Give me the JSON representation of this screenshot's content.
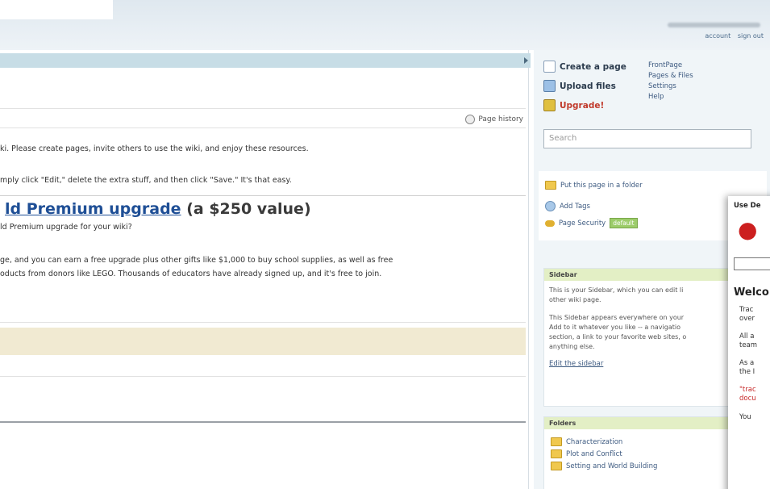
{
  "header": {
    "account_link": "account",
    "signout_link": "sign out"
  },
  "main": {
    "page_history": "Page history",
    "welcome_line": "ki.  Please create pages, invite others to use the wiki, and enjoy these resources.",
    "edit_line": "mply click \"Edit,\" delete the extra stuff, and then click \"Save.\"  It's that easy.",
    "promo_link": "ld Premium upgrade",
    "promo_value": " (a $250 value)",
    "promo_sub": "ld Premium upgrade for your wiki?",
    "promo_body_1": "ge, and you can earn a free upgrade plus other gifts like $1,000 to buy school supplies, as well as free",
    "promo_body_2": "oducts from donors like LEGO.  Thousands of educators have already signed up, and it's free to join."
  },
  "sidebar": {
    "create_page": "Create a page",
    "upload_files": "Upload files",
    "upgrade": "Upgrade!",
    "nav": [
      "FrontPage",
      "Pages & Files",
      "Settings",
      "Help"
    ],
    "search_placeholder": "Search",
    "put_in_folder": "Put this page in a folder",
    "add_tags": "Add Tags",
    "page_security": "Page Security",
    "security_badge": "default",
    "sidebar_panel_title": "Sidebar",
    "sidebar_text_1": "This is your Sidebar, which you can edit li",
    "sidebar_text_2": "other wiki page.",
    "sidebar_text_3": "This Sidebar appears everywhere on your",
    "sidebar_text_4": "Add to it whatever you like -- a navigatio",
    "sidebar_text_5": "section, a link to your favorite web sites, o",
    "sidebar_text_6": "anything else.",
    "edit_sidebar": "Edit the sidebar",
    "folders_title": "Folders",
    "folders": [
      "Characterization",
      "Plot and Conflict",
      "Setting and World Building"
    ]
  },
  "overlay_doc": {
    "heading": "Use De",
    "welcome": "Welco",
    "lines": [
      "Trac",
      "over",
      "All a",
      "team",
      "As a",
      "the I",
      "\"trac",
      "docu",
      "You"
    ]
  },
  "colors": {
    "link": "#1f4f96",
    "header_strip": "#c7dde6",
    "panel_header": "#e3efc5",
    "band": "#f1ead2"
  }
}
